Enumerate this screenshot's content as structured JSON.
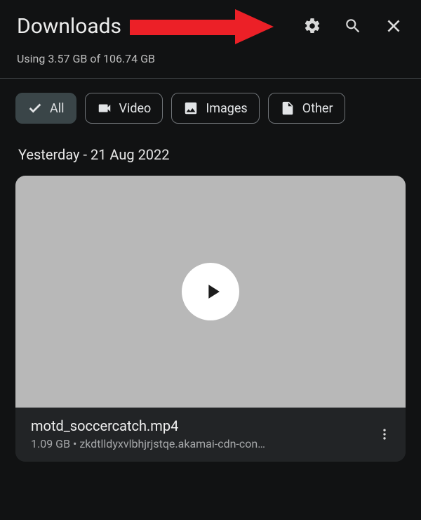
{
  "header": {
    "title": "Downloads"
  },
  "storage": {
    "text": "Using 3.57 GB of 106.74 GB"
  },
  "filters": {
    "all": {
      "label": "All"
    },
    "video": {
      "label": "Video"
    },
    "images": {
      "label": "Images"
    },
    "other": {
      "label": "Other"
    }
  },
  "section": {
    "heading": "Yesterday - 21 Aug 2022"
  },
  "file": {
    "name": "motd_soccercatch.mp4",
    "meta": "1.09 GB • zkdtlldyxvlbhjrjstqe.akamai-cdn-con…"
  },
  "annotation": {
    "target": "settings-icon"
  }
}
